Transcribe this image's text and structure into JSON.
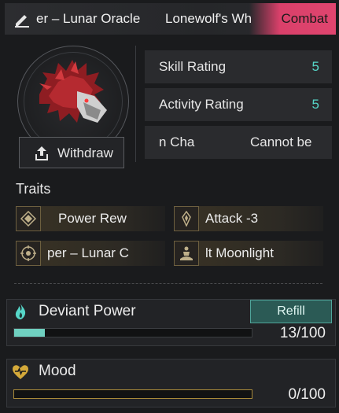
{
  "header": {
    "title_left": "er – Lunar Oracle",
    "title_right": "Lonewolf's Wh",
    "combat_label": "Combat"
  },
  "withdraw_label": "Withdraw",
  "ratings": [
    {
      "label": "Skill Rating",
      "value": "5"
    },
    {
      "label": "Activity Rating",
      "value": "5"
    },
    {
      "label": "n Cha",
      "value": "Cannot be"
    }
  ],
  "traits_title": "Traits",
  "traits": [
    {
      "label": "Power Rew",
      "icon": "diamond-icon"
    },
    {
      "label": "Attack -3",
      "icon": "crystal-icon"
    },
    {
      "label": "per – Lunar C",
      "icon": "compass-icon"
    },
    {
      "label": "lt   Moonlight",
      "icon": "meditate-icon"
    }
  ],
  "deviant_power": {
    "label": "Deviant Power",
    "refill_label": "Refill",
    "value_text": "13/100",
    "fraction": 0.13,
    "color": "#6fd0c0"
  },
  "mood": {
    "label": "Mood",
    "value_text": "0/100",
    "fraction": 0.0,
    "color": "#d4a93a"
  },
  "colors": {
    "accent_teal": "#56d6c8",
    "combat_pink": "#e0456f",
    "gold": "#d4a93a"
  }
}
